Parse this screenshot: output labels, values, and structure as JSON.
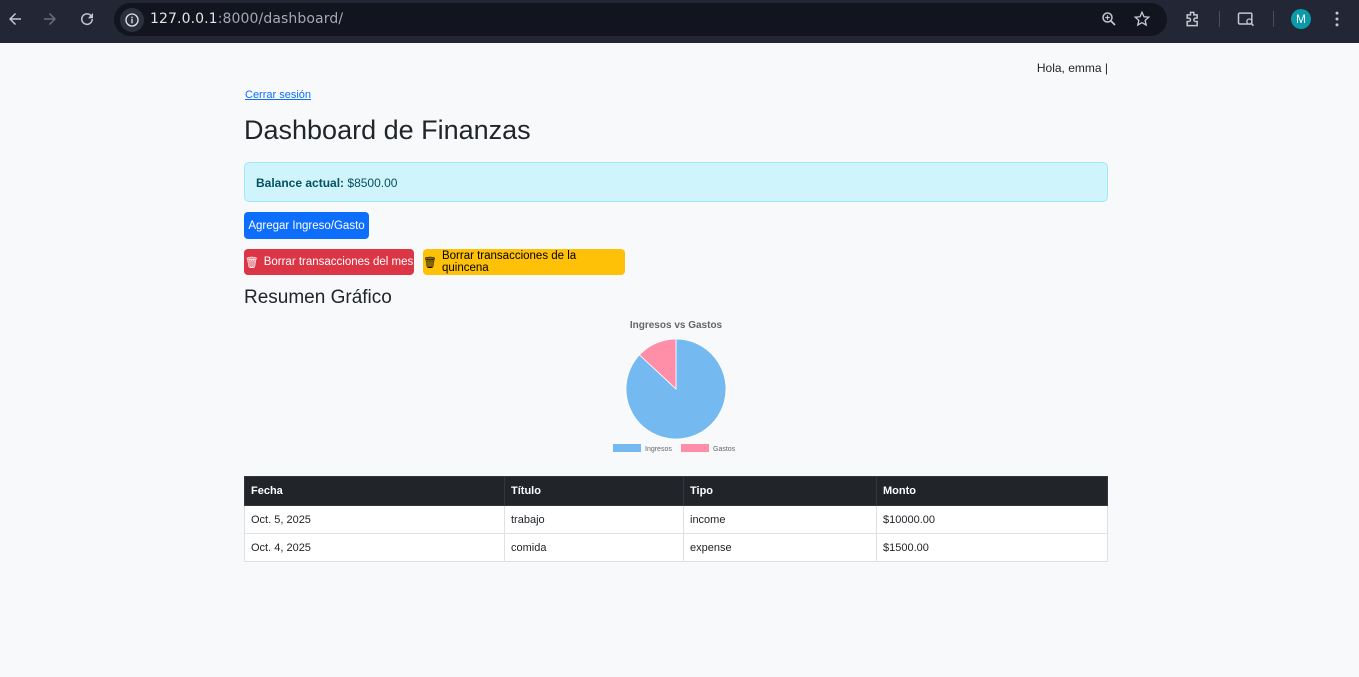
{
  "browser": {
    "url_host": "127.0.0.1",
    "url_rest": ":8000/dashboard/",
    "profile_initial": "M"
  },
  "header": {
    "greeting": "Hola, emma |",
    "logout_label": "Cerrar sesión"
  },
  "page": {
    "title": "Dashboard de Finanzas",
    "balance_label": "Balance actual:",
    "balance_value": "$8500.00",
    "add_button": "Agregar Ingreso/Gasto",
    "delete_month_button": "Borrar transacciones del mes",
    "delete_fortnight_button": "Borrar transacciones de la quincena",
    "summary_title": "Resumen Gráfico"
  },
  "chart_data": {
    "type": "pie",
    "title": "Ingresos vs Gastos",
    "categories": [
      "Ingresos",
      "Gastos"
    ],
    "values": [
      10000,
      1500
    ],
    "colors": [
      "#74baf0",
      "#ff8fa8"
    ],
    "legend_position": "bottom"
  },
  "table": {
    "headers": [
      "Fecha",
      "Título",
      "Tipo",
      "Monto"
    ],
    "rows": [
      [
        "Oct. 5, 2025",
        "trabajo",
        "income",
        "$10000.00"
      ],
      [
        "Oct. 4, 2025",
        "comida",
        "expense",
        "$1500.00"
      ]
    ]
  }
}
